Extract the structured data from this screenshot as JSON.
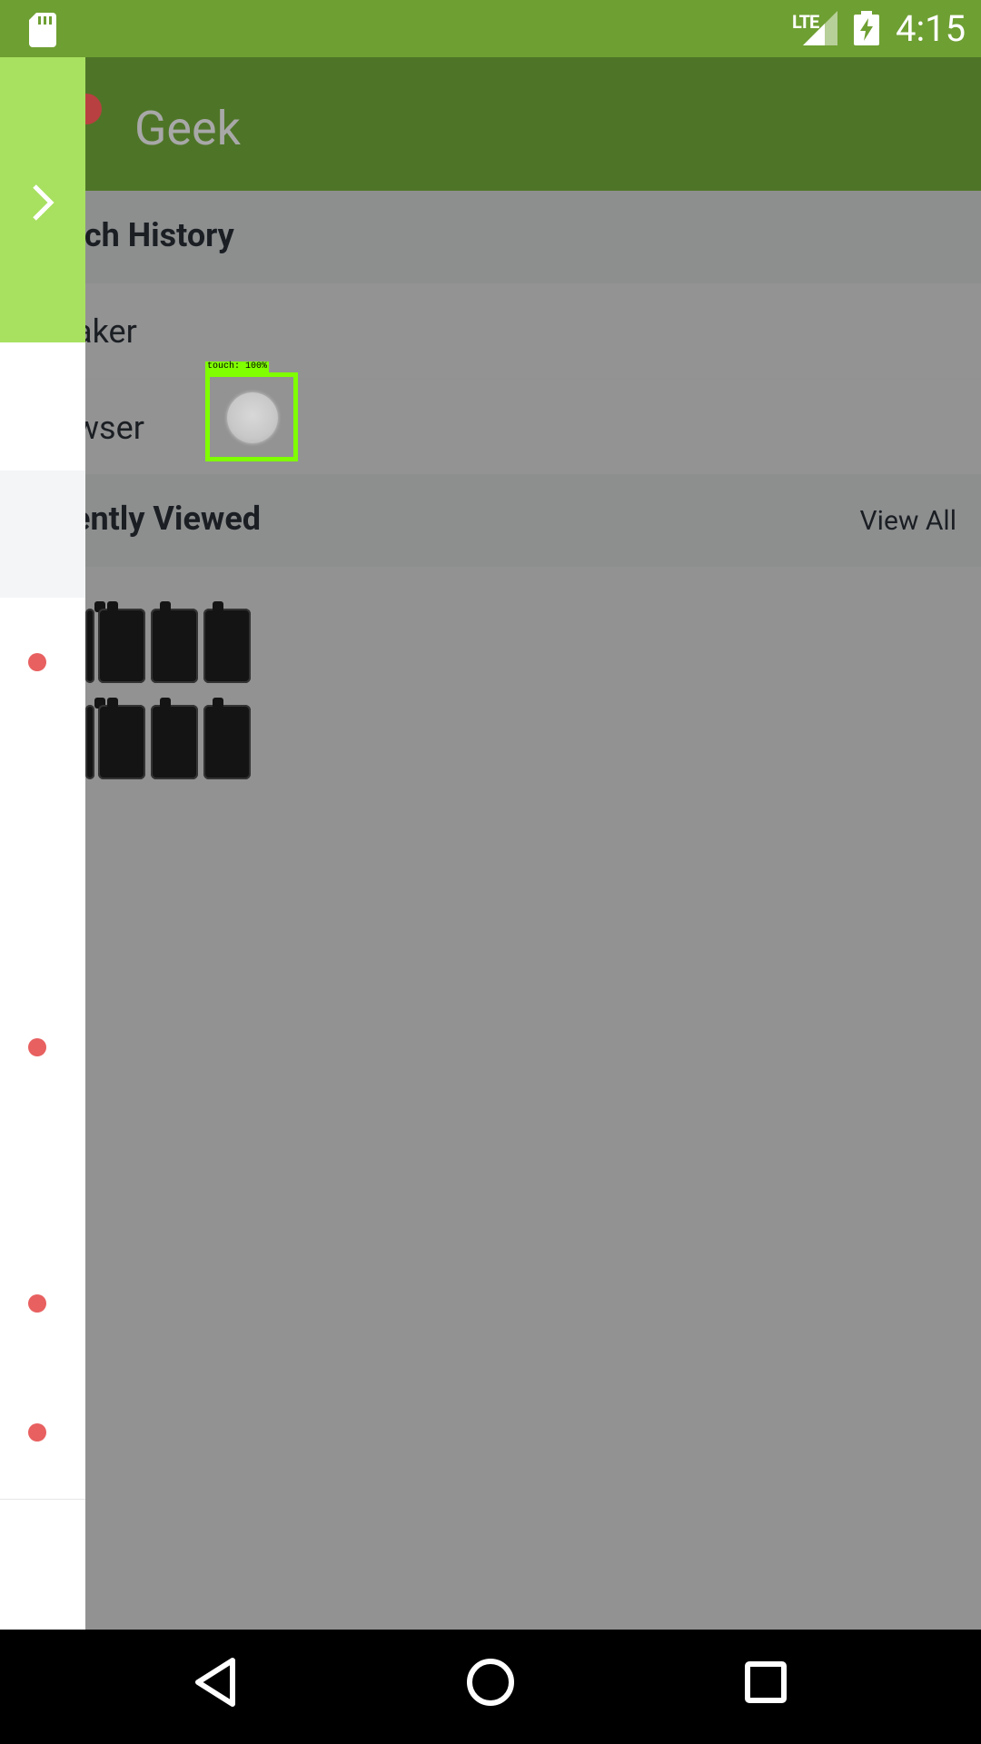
{
  "status_bar": {
    "network": "LTE",
    "time": "4:15"
  },
  "app_bar": {
    "title": "Geek"
  },
  "search_history": {
    "header": "rch History",
    "items": [
      "aker",
      "wser"
    ]
  },
  "recently_viewed": {
    "header": "ently Viewed",
    "view_all": "View All"
  },
  "touch_overlay": {
    "label": "touch: 100%"
  },
  "colors": {
    "status_bar": "#6e9f32",
    "app_bar": "#4e7527",
    "drawer_toggle": "#a8e060",
    "drawer_dot": "#e86060",
    "overlay_grey": "#929292"
  },
  "icons": {
    "sd_card": "sd-card-icon",
    "signal": "signal-icon",
    "battery": "battery-charging-icon",
    "chevron": "chevron-right-icon",
    "back": "back-icon",
    "home": "home-icon",
    "recents": "recents-icon"
  }
}
